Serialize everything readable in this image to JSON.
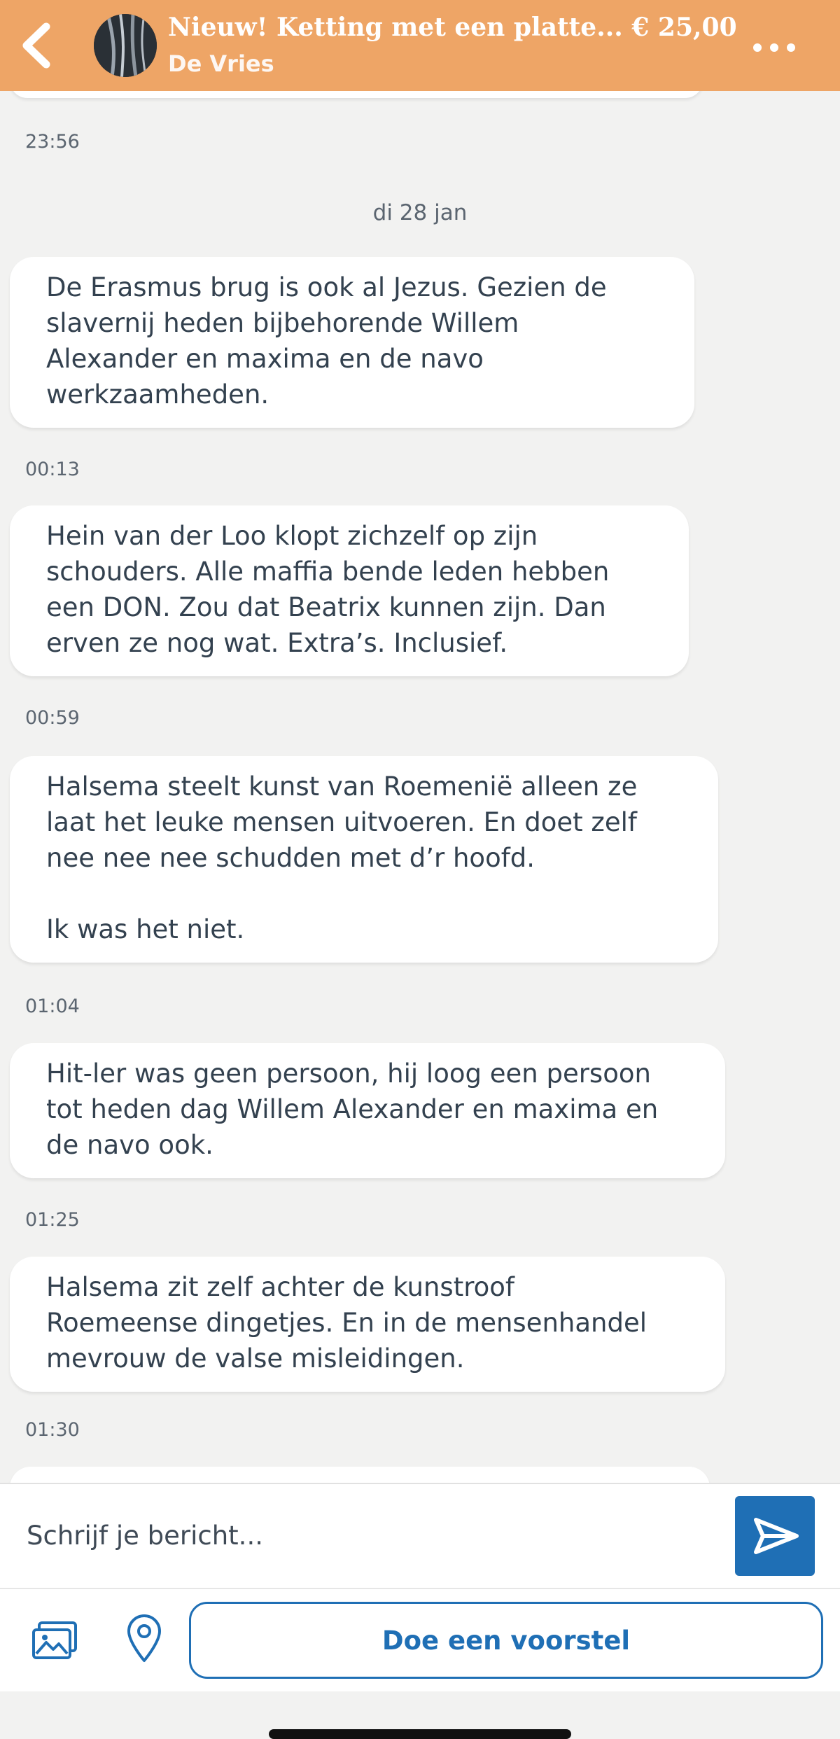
{
  "header": {
    "title": "Nieuw! Ketting met een platte... € 25,00",
    "subtitle": "De Vries",
    "back_icon": "chevron-left-icon",
    "more_icon": "more-dots-icon",
    "color": "#eea566"
  },
  "chat": {
    "top_timestamp": "23:56",
    "date_separator": "di 28 jan",
    "messages": [
      {
        "lines": [
          "De Erasmus brug is ook al Jezus. Gezien de",
          "slavernij heden bijbehorende Willem",
          "Alexander en maxima en de navo",
          "werkzaamheden."
        ],
        "time": "00:13"
      },
      {
        "lines": [
          "Hein van der Loo klopt zichzelf op zijn",
          "schouders. Alle maffia bende leden hebben",
          "een DON. Zou dat Beatrix kunnen zijn. Dan",
          "erven ze nog wat. Extra’s. Inclusief."
        ],
        "time": "00:59"
      },
      {
        "lines": [
          "Halsema steelt kunst van Roemenië alleen ze",
          "laat het leuke mensen uitvoeren. En doet zelf",
          "nee nee nee schudden met d’r hoofd.",
          "",
          "Ik was het niet."
        ],
        "time": "01:04"
      },
      {
        "lines": [
          "Hit-ler was geen persoon, hij loog een persoon",
          "tot heden dag Willem Alexander en maxima en",
          "de navo ook."
        ],
        "time": "01:25"
      },
      {
        "lines": [
          "Halsema zit zelf achter de kunstroof",
          "Roemeense dingetjes. En in de mensenhandel",
          "mevrouw de valse misleidingen."
        ],
        "time": "01:30"
      }
    ]
  },
  "composer": {
    "placeholder": "Schrijf je bericht...",
    "send_icon": "send-icon"
  },
  "actions": {
    "photo_icon": "photo-icon",
    "location_icon": "location-pin-icon",
    "offer_label": "Doe een voorstel",
    "accent": "#1f6fb5"
  }
}
